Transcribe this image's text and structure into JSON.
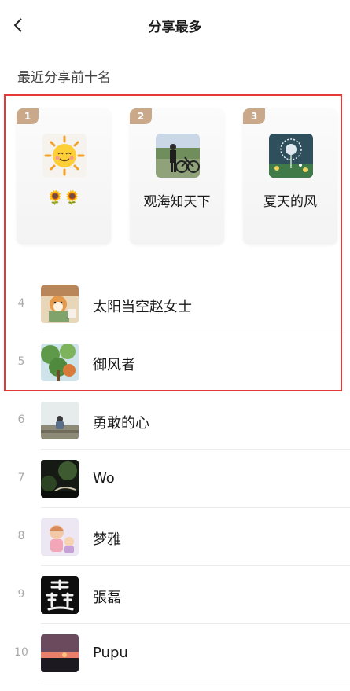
{
  "header": {
    "title": "分享最多"
  },
  "section_label": "最近分享前十名",
  "top3": [
    {
      "rank": "1",
      "name": "🌻🌻",
      "icon": "sun-avatar"
    },
    {
      "rank": "2",
      "name": "观海知天下",
      "icon": "person-bicycle-avatar"
    },
    {
      "rank": "3",
      "name": "夏天的风",
      "icon": "dandelion-avatar"
    }
  ],
  "list": [
    {
      "rank": "4",
      "name": "太阳当空赵女士",
      "icon": "shiba-dog-avatar"
    },
    {
      "rank": "5",
      "name": "御风者",
      "icon": "tree-leaves-avatar"
    },
    {
      "rank": "6",
      "name": "勇敢的心",
      "icon": "seated-figure-avatar"
    },
    {
      "rank": "7",
      "name": "Wo",
      "icon": "dark-forest-avatar"
    },
    {
      "rank": "8",
      "name": "梦雅",
      "icon": "cartoon-girl-avatar"
    },
    {
      "rank": "9",
      "name": "張磊",
      "icon": "calligraphy-avatar"
    },
    {
      "rank": "10",
      "name": "Pupu",
      "icon": "sunset-avatar"
    }
  ],
  "colors": {
    "rank_tag": "#c9a98a",
    "highlight": "#e53935"
  }
}
